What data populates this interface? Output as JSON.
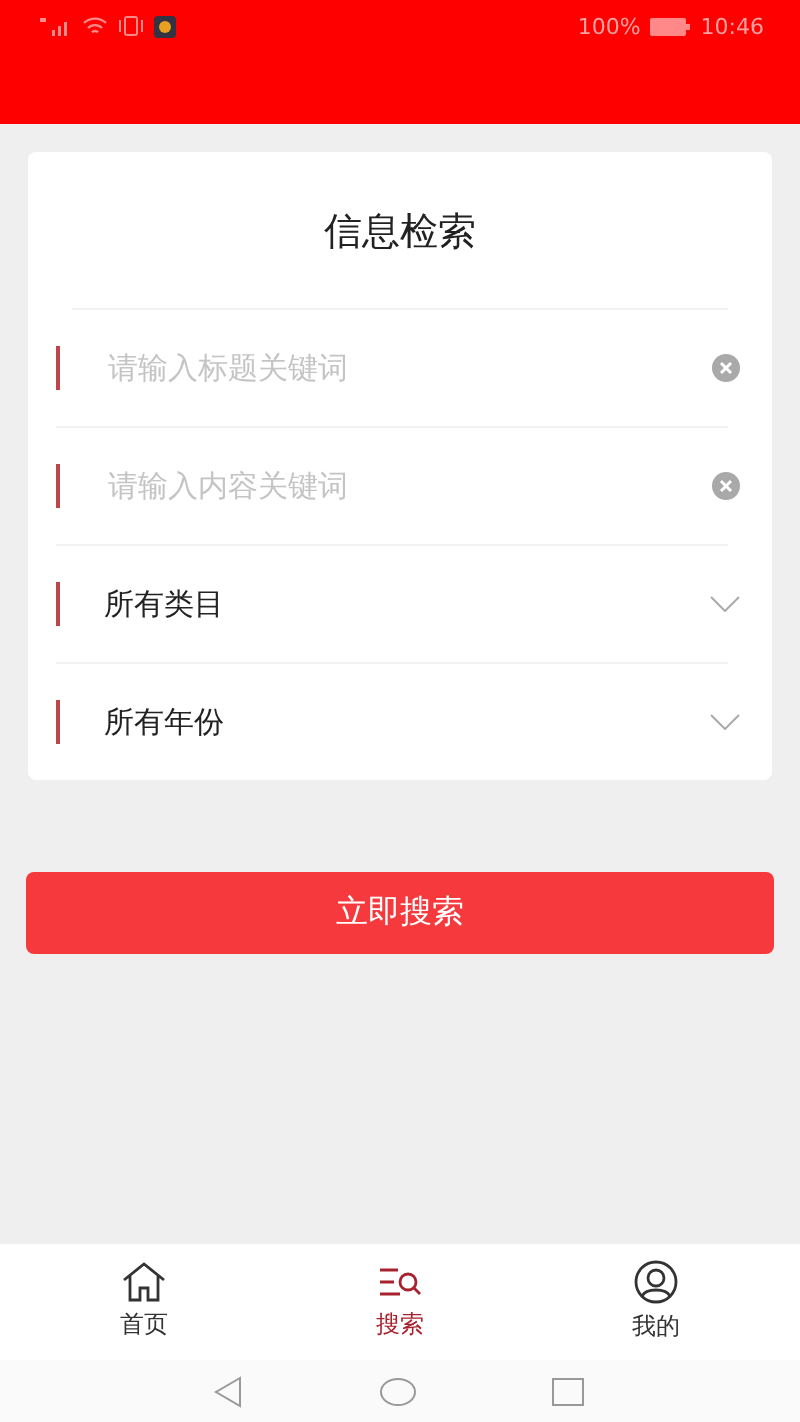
{
  "status_bar": {
    "battery": "100%",
    "time": "10:46"
  },
  "form": {
    "title": "信息检索",
    "fields": [
      {
        "kind": "input",
        "placeholder": "请输入标题关键词"
      },
      {
        "kind": "input",
        "placeholder": "请输入内容关键词"
      },
      {
        "kind": "select",
        "value": "所有类目"
      },
      {
        "kind": "select",
        "value": "所有年份"
      }
    ]
  },
  "search_button": "立即搜索",
  "tabs": [
    {
      "label": "首页",
      "kind": "home",
      "selected": false
    },
    {
      "label": "搜索",
      "kind": "search",
      "selected": true
    },
    {
      "label": "我的",
      "kind": "user",
      "selected": false
    }
  ]
}
